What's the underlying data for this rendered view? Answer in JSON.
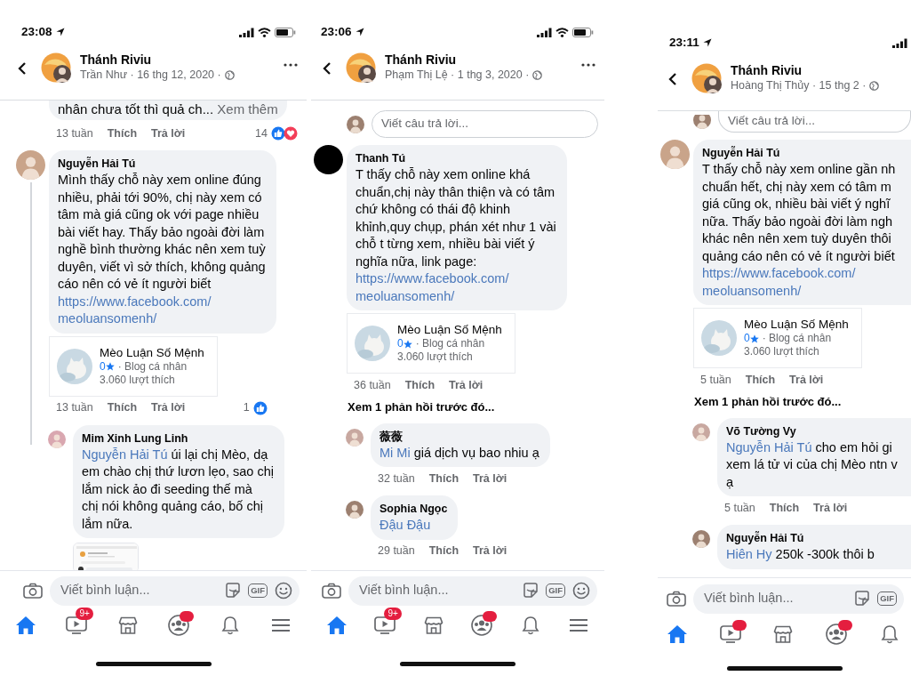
{
  "screens": [
    {
      "status_bar": {
        "time": "23:08"
      },
      "header": {
        "title": "Thánh Riviu",
        "subtitle": "Trần Như · 16 thg 12, 2020 ·",
        "more": true
      },
      "items": [
        {
          "kind": "comment_tail",
          "text": "nhân chưa tốt thì quả ch...",
          "see_more": "Xem thêm",
          "time": "13 tuần",
          "like": "Thích",
          "reply": "Trả lời",
          "reactions": {
            "count": "14",
            "items": [
              {
                "kind": "like"
              },
              {
                "kind": "love"
              }
            ]
          }
        },
        {
          "kind": "comment",
          "author": "Nguyễn Hải Tú",
          "thread": true,
          "lines": [
            "Mình thấy chỗ này xem online đúng",
            "nhiều, phải tới 90%, chị này xem có",
            "tâm mà giá cũng ok với page nhiều",
            "bài viết hay. Thấy bảo ngoài đời làm",
            "nghề bình thường khác nên xem tuỳ",
            "duyên, viết vì sở thích, không quảng",
            "cáo nên có vẻ ít người biết"
          ],
          "link": [
            "https://www.facebook.com/",
            "meoluansomenh/"
          ],
          "card": {
            "name": "Mèo Luận Số Mệnh",
            "rating": "0",
            "category": "· Blog cá nhân",
            "likes": "3.060 lượt thích"
          },
          "time": "13 tuần",
          "like": "Thích",
          "reply": "Trả lời",
          "reactions": {
            "count": "1",
            "items": [
              {
                "kind": "like"
              }
            ]
          }
        },
        {
          "kind": "reply",
          "author": "Mim Xinh Lung Linh",
          "mention": "Nguyễn Hải Tú",
          "lines": [
            "úi lại chị Mèo, dạ",
            "em chào chị thứ lươn lẹo, sao chị",
            "lắm nick ảo đi seeding thế mà",
            "chị nói không quảng cáo, bố chị",
            "lắm nữa."
          ],
          "attachment": {
            "kind": "picture"
          }
        }
      ],
      "composer": {
        "placeholder": "Viết bình luận...",
        "tools": [
          {
            "kind": "sticker"
          },
          {
            "kind": "gif",
            "label": "GIF"
          },
          {
            "kind": "emoji"
          }
        ]
      },
      "tab_bar": [
        {
          "kind": "home",
          "selected": true
        },
        {
          "kind": "video",
          "selected": false,
          "badge": "9+"
        },
        {
          "kind": "store",
          "selected": false
        },
        {
          "kind": "groups",
          "selected": false,
          "dot": true
        },
        {
          "kind": "bell",
          "selected": false
        },
        {
          "kind": "menu",
          "selected": false
        }
      ]
    },
    {
      "status_bar": {
        "time": "23:06"
      },
      "header": {
        "title": "Thánh Riviu",
        "subtitle": "Phạm Thị Lệ · 1 thg 3, 2020 ·",
        "more": true
      },
      "items": [
        {
          "kind": "reply_field",
          "placeholder": "Viết câu trả lời..."
        },
        {
          "kind": "comment",
          "author": "Thanh Tú",
          "lines": [
            "T thấy chỗ này xem online khá",
            "chuẩn,chị này thân thiện và có tâm",
            "chứ không có thái độ khinh",
            "khỉnh,quy chụp, phán xét như 1 vài",
            "chỗ t từng xem, nhiều bài viết ý",
            "nghĩa nữa, link page:"
          ],
          "link": [
            "https://www.facebook.com/",
            "meoluansomenh/"
          ],
          "card": {
            "name": "Mèo Luận Số Mệnh",
            "rating": "0",
            "category": "· Blog cá nhân",
            "likes": "3.060 lượt thích"
          },
          "time": "36 tuần",
          "like": "Thích",
          "reply": "Trả lời"
        },
        {
          "kind": "more_replies",
          "text": "Xem 1 phản hồi trước đó..."
        },
        {
          "kind": "reply",
          "author": "薇薇",
          "mention": "Mi Mi",
          "lines": [
            "giá dịch vụ bao nhiu ạ"
          ],
          "time": "32 tuần",
          "like": "Thích",
          "reply": "Trả lời"
        },
        {
          "kind": "reply",
          "author": "Sophia Ngọc",
          "mention": "Đậu Đậu",
          "time": "29 tuần",
          "like": "Thích",
          "reply": "Trả lời"
        }
      ],
      "composer": {
        "placeholder": "Viết bình luận...",
        "tools": [
          {
            "kind": "sticker"
          },
          {
            "kind": "gif",
            "label": "GIF"
          },
          {
            "kind": "emoji"
          }
        ]
      },
      "tab_bar": [
        {
          "kind": "home",
          "selected": true
        },
        {
          "kind": "video",
          "selected": false,
          "badge": "9+"
        },
        {
          "kind": "store",
          "selected": false
        },
        {
          "kind": "groups",
          "selected": false,
          "dot": true
        },
        {
          "kind": "bell",
          "selected": false
        },
        {
          "kind": "menu",
          "selected": false
        }
      ]
    },
    {
      "status_bar": {
        "time": "23:11"
      },
      "header": {
        "title": "Thánh Riviu",
        "subtitle": "Hoàng Thị Thủy · 15 thg 2 ·"
      },
      "items": [
        {
          "kind": "reply_field",
          "placeholder": "Viết câu trả lời...",
          "cut": true
        },
        {
          "kind": "comment",
          "author": "Nguyễn Hải Tú",
          "lines": [
            "T thấy chỗ này xem online gần nh",
            "chuẩn hết, chị này xem có tâm m",
            "giá cũng ok, nhiều bài viết ý nghĩ",
            "nữa. Thấy bảo ngoài đời làm ngh",
            "khác nên nên xem tuỳ duyên thôi",
            "quảng cáo nên có vẻ ít người biết"
          ],
          "link": [
            "https://www.facebook.com/",
            "meoluansomenh/"
          ],
          "card": {
            "name": "Mèo Luận Số Mệnh",
            "rating": "0",
            "category": "· Blog cá nhân",
            "likes": "3.060 lượt thích"
          },
          "time": "5 tuần",
          "like": "Thích",
          "reply": "Trả lời"
        },
        {
          "kind": "more_replies",
          "text": "Xem 1 phản hồi trước đó..."
        },
        {
          "kind": "reply",
          "author": "Võ Tường Vy",
          "mention": "Nguyễn Hải Tú",
          "lines": [
            "cho em hỏi gi",
            "xem lá tử vi của chị Mèo ntn v",
            "ạ"
          ],
          "time": "5 tuần",
          "like": "Thích",
          "reply": "Trả lời"
        },
        {
          "kind": "reply",
          "author": "Nguyễn Hải Tú",
          "mention": "Hiên Hy",
          "lines": [
            "250k -300k thôi b"
          ]
        }
      ],
      "composer": {
        "placeholder": "Viết bình luận...",
        "tools": [
          {
            "kind": "sticker"
          },
          {
            "kind": "gif",
            "label": "GIF"
          }
        ]
      },
      "tab_bar": [
        {
          "kind": "home",
          "selected": true
        },
        {
          "kind": "video",
          "selected": false,
          "dot": true
        },
        {
          "kind": "store",
          "selected": false
        },
        {
          "kind": "groups",
          "selected": false,
          "dot": true
        },
        {
          "kind": "bell",
          "selected": false
        }
      ]
    }
  ]
}
